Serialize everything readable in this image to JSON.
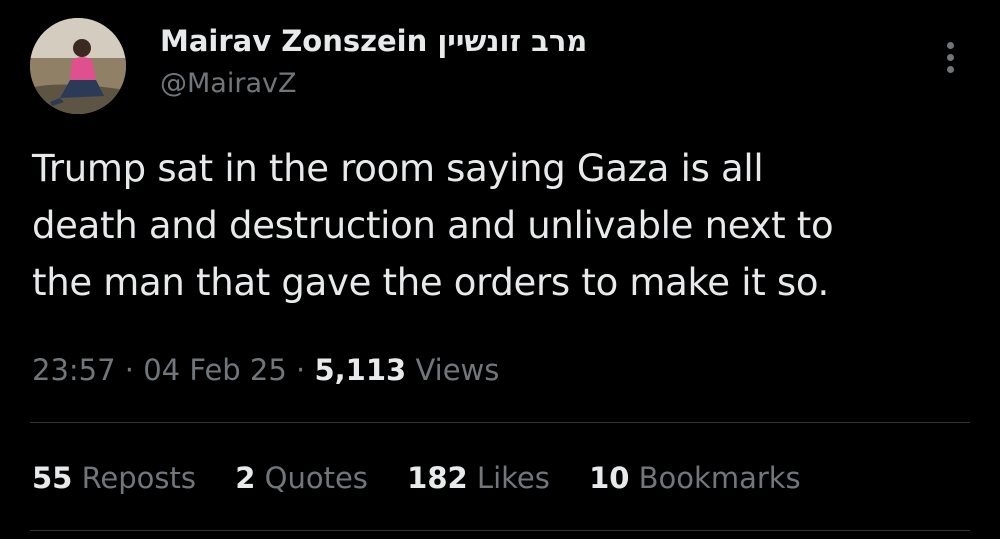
{
  "author": {
    "display_name": "Mairav Zonszein מרב זונשיין",
    "handle": "@MairavZ"
  },
  "tweet": {
    "text": "Trump sat in the room saying Gaza is all\ndeath and destruction and unlivable next to\nthe man that gave the orders to make it so."
  },
  "meta": {
    "time": "23:57",
    "separator": "·",
    "date": "04 Feb 25",
    "views_count": "5,113",
    "views_label": "Views"
  },
  "stats": [
    {
      "count": "55",
      "label": "Reposts"
    },
    {
      "count": "2",
      "label": "Quotes"
    },
    {
      "count": "182",
      "label": "Likes"
    },
    {
      "count": "10",
      "label": "Bookmarks"
    }
  ],
  "icons": {
    "more": "more-vertical-icon"
  },
  "colors": {
    "background": "#000000",
    "primary_text": "#e7e9ea",
    "secondary_text": "#71767b",
    "divider": "#2f3336"
  }
}
